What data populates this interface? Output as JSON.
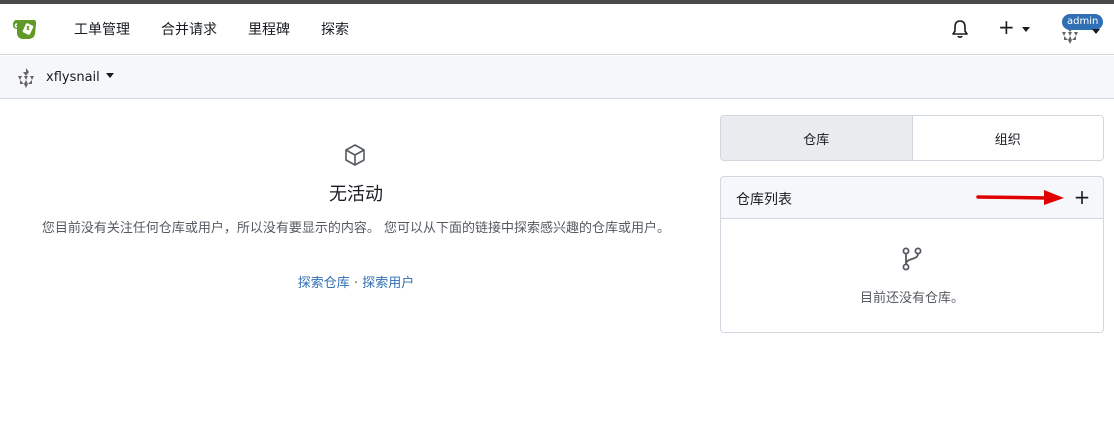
{
  "nav": {
    "items": [
      "工单管理",
      "合并请求",
      "里程碑",
      "探索"
    ],
    "admin_badge": "admin"
  },
  "context": {
    "username": "xflysnail"
  },
  "feed": {
    "title": "无活动",
    "description": "您目前没有关注任何仓库或用户，所以没有要显示的内容。 您可以从下面的链接中探索感兴趣的仓库或用户。",
    "explore_repos": "探索仓库",
    "separator": "·",
    "explore_users": "探索用户"
  },
  "dashboard": {
    "tabs": [
      "仓库",
      "组织"
    ],
    "active_tab": "仓库",
    "repo_list_title": "仓库列表",
    "add_label": "+",
    "empty_text": "目前还没有仓库。"
  },
  "colors": {
    "logo": "#609926",
    "link": "#2f6fb3",
    "badge": "#2f6fb3",
    "annotation_arrow": "#e00000"
  },
  "icons": {
    "logo": "gitea-logo",
    "bell": "bell-icon",
    "plus": "plus-icon",
    "feed": "package-icon",
    "repo_empty": "repo-forked-icon"
  }
}
